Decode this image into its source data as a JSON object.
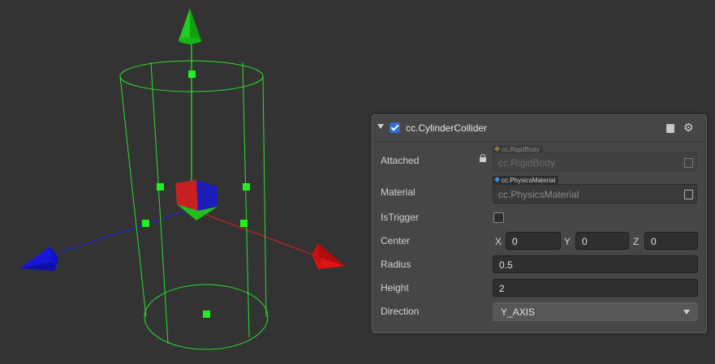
{
  "scene": {
    "gizmo_colors": {
      "y_axis": "#19d219",
      "x_axis": "#e01010",
      "z_axis": "#1414d8",
      "collider_wire": "#22ee22"
    }
  },
  "inspector": {
    "component_title": "cc.CylinderCollider",
    "enabled": true,
    "accent": "#2f6fd6",
    "fields": {
      "attached": {
        "label": "Attached",
        "tag": "cc.RigidBody",
        "value": "cc.RigidBody",
        "tag_icon": "rigidbody-icon"
      },
      "material": {
        "label": "Material",
        "tag": "cc.PhysicsMaterial",
        "value": "cc.PhysicsMaterial",
        "tag_icon": "material-icon"
      },
      "is_trigger": {
        "label": "IsTrigger",
        "checked": false
      },
      "center": {
        "label": "Center",
        "x_label": "X",
        "y_label": "Y",
        "z_label": "Z",
        "x": "0",
        "y": "0",
        "z": "0"
      },
      "radius": {
        "label": "Radius",
        "value": "0.5"
      },
      "height": {
        "label": "Height",
        "value": "2"
      },
      "direction": {
        "label": "Direction",
        "value": "Y_AXIS"
      }
    }
  }
}
